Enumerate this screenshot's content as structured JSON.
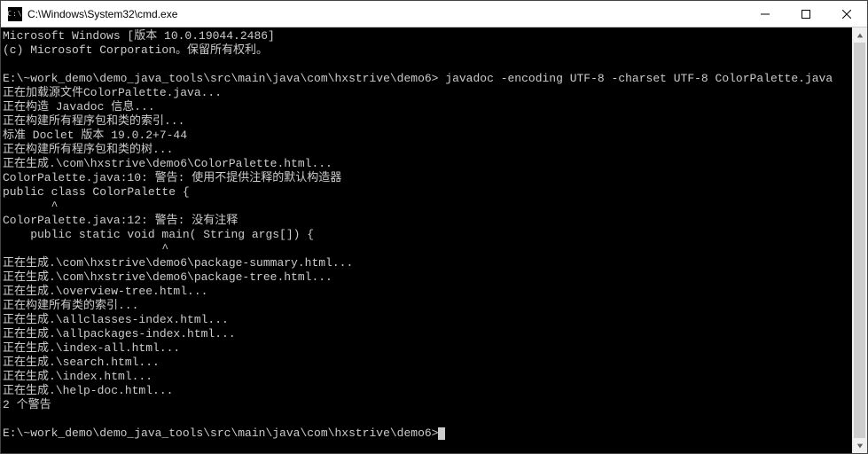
{
  "titlebar": {
    "icon_label": "C:\\",
    "title": "C:\\Windows\\System32\\cmd.exe"
  },
  "terminal": {
    "lines": [
      "Microsoft Windows [版本 10.0.19044.2486]",
      "(c) Microsoft Corporation。保留所有权利。",
      "",
      "E:\\~work_demo\\demo_java_tools\\src\\main\\java\\com\\hxstrive\\demo6> javadoc -encoding UTF-8 -charset UTF-8 ColorPalette.java",
      "正在加载源文件ColorPalette.java...",
      "正在构造 Javadoc 信息...",
      "正在构建所有程序包和类的索引...",
      "标准 Doclet 版本 19.0.2+7-44",
      "正在构建所有程序包和类的树...",
      "正在生成.\\com\\hxstrive\\demo6\\ColorPalette.html...",
      "ColorPalette.java:10: 警告: 使用不提供注释的默认构造器",
      "public class ColorPalette {",
      "       ^",
      "ColorPalette.java:12: 警告: 没有注释",
      "    public static void main( String args[]) {",
      "                       ^",
      "正在生成.\\com\\hxstrive\\demo6\\package-summary.html...",
      "正在生成.\\com\\hxstrive\\demo6\\package-tree.html...",
      "正在生成.\\overview-tree.html...",
      "正在构建所有类的索引...",
      "正在生成.\\allclasses-index.html...",
      "正在生成.\\allpackages-index.html...",
      "正在生成.\\index-all.html...",
      "正在生成.\\search.html...",
      "正在生成.\\index.html...",
      "正在生成.\\help-doc.html...",
      "2 个警告",
      ""
    ],
    "prompt": "E:\\~work_demo\\demo_java_tools\\src\\main\\java\\com\\hxstrive\\demo6>"
  }
}
